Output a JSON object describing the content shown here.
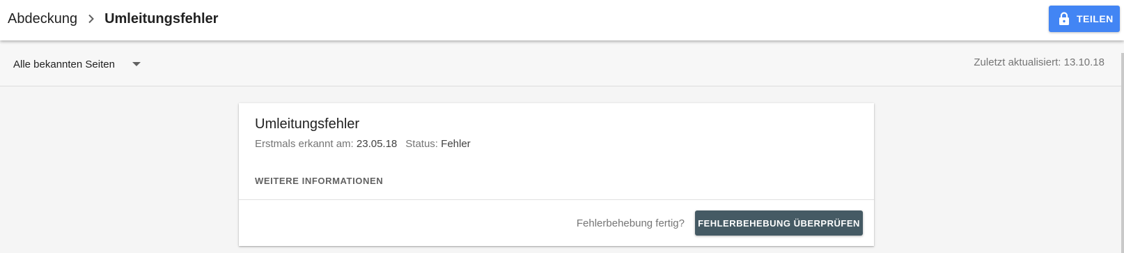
{
  "header": {
    "breadcrumb_parent": "Abdeckung",
    "breadcrumb_separator_icon": "chevron-right-icon",
    "breadcrumb_current": "Umleitungsfehler",
    "share_button": {
      "label": "TEILEN",
      "icon": "lock-icon",
      "color": "#4285f4"
    }
  },
  "filter": {
    "selected": "Alle bekannten Seiten",
    "dropdown_icon": "caret-down-icon",
    "last_updated": "Zuletzt aktualisiert: 13.10.18"
  },
  "card": {
    "title": "Umleitungsfehler",
    "first_detected_label": "Erstmals erkannt am:",
    "first_detected_value": "23.05.18",
    "status_label": "Status:",
    "status_value": "Fehler",
    "more_info": "WEITERE INFORMATIONEN",
    "fix_prompt": "Fehlerbehebung fertig?",
    "validate_button": {
      "label": "FEHLERBEHEBUNG ÜBERPRÜFEN",
      "color": "#455a64"
    }
  }
}
